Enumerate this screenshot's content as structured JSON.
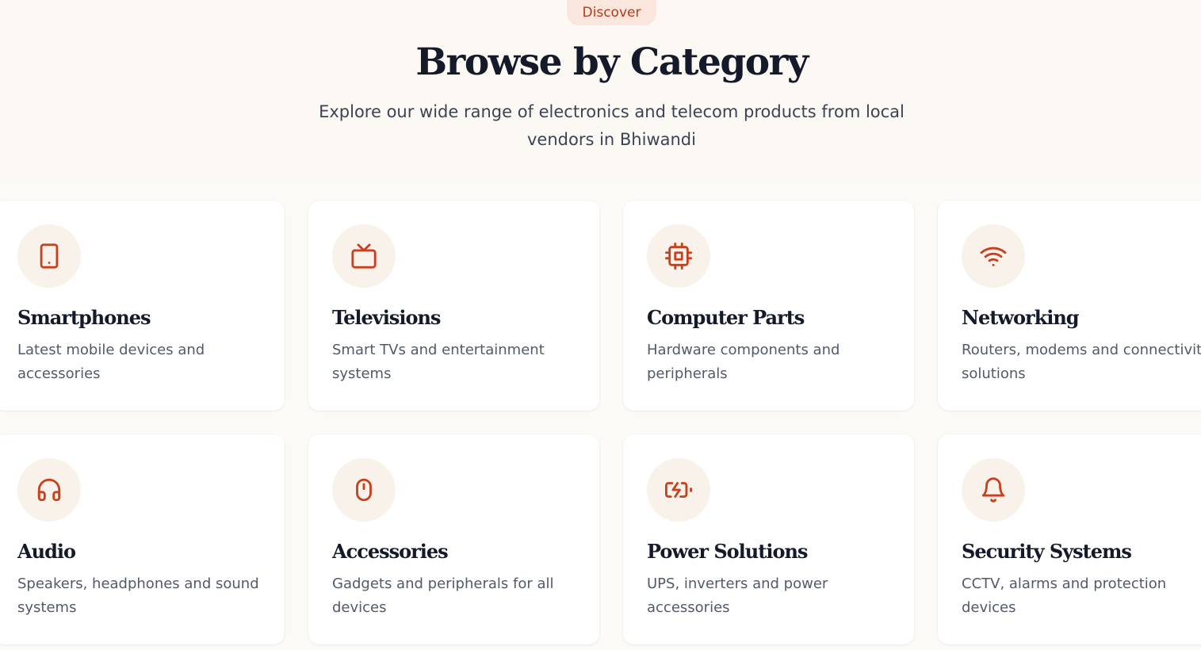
{
  "header": {
    "pill_label": "Discover",
    "title": "Browse by Category",
    "subtitle": "Explore our wide range of electronics and telecom products from local vendors in Bhiwandi"
  },
  "colors": {
    "accent": "#c8401e",
    "pill_bg": "#fbe6dd",
    "icon_bg": "#f8f2ea",
    "page_bg": "#fcfaf6"
  },
  "categories": [
    {
      "icon": "smartphone-icon",
      "title": "Smartphones",
      "description": "Latest mobile devices and accessories"
    },
    {
      "icon": "tv-icon",
      "title": "Televisions",
      "description": "Smart TVs and entertainment systems"
    },
    {
      "icon": "cpu-icon",
      "title": "Computer Parts",
      "description": "Hardware components and peripherals"
    },
    {
      "icon": "wifi-icon",
      "title": "Networking",
      "description": "Routers, modems and connectivity solutions"
    },
    {
      "icon": "headphones-icon",
      "title": "Audio",
      "description": "Speakers, headphones and sound systems"
    },
    {
      "icon": "mouse-icon",
      "title": "Accessories",
      "description": "Gadgets and peripherals for all devices"
    },
    {
      "icon": "battery-charging-icon",
      "title": "Power Solutions",
      "description": "UPS, inverters and power accessories"
    },
    {
      "icon": "bell-icon",
      "title": "Security Systems",
      "description": "CCTV, alarms and protection devices"
    }
  ]
}
